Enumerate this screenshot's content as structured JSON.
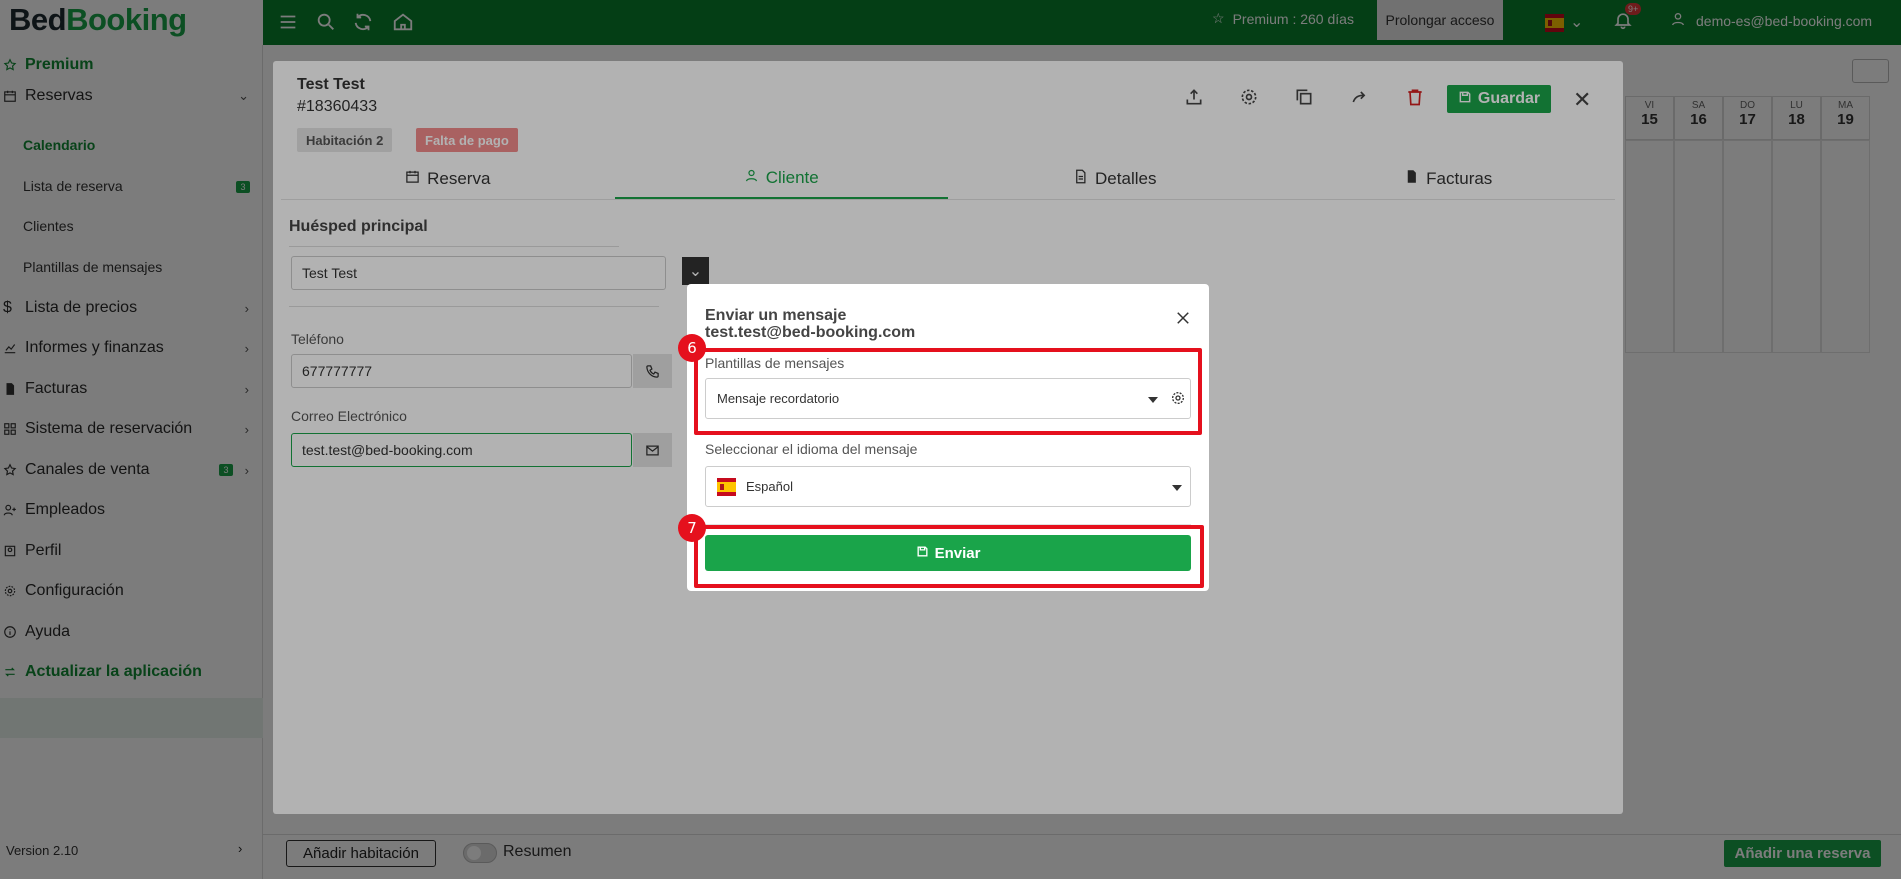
{
  "app": {
    "logo_part1": "Bed",
    "logo_part2": "Booking",
    "premium_text": "Premium : 260 días",
    "prolong_label": "Prolongar acceso",
    "notifications_badge": "9+",
    "user_email": "demo-es@bed-booking.com"
  },
  "sidebar": {
    "premium": "Premium",
    "reservas": "Reservas",
    "sub_calendario": "Calendario",
    "sub_lista": "Lista de reserva",
    "sub_lista_badge": "3",
    "sub_clientes": "Clientes",
    "sub_plantillas": "Plantillas de mensajes",
    "lista_precios": "Lista de precios",
    "informes": "Informes y finanzas",
    "facturas": "Facturas",
    "sistema": "Sistema de reservación",
    "canales": "Canales de venta",
    "canales_badge": "3",
    "empleados": "Empleados",
    "perfil": "Perfil",
    "configuracion": "Configuración",
    "ayuda": "Ayuda",
    "actualizar": "Actualizar la aplicación",
    "version": "Version 2.10"
  },
  "calendar": {
    "days": [
      {
        "name": "VI",
        "num": "15"
      },
      {
        "name": "SA",
        "num": "16"
      },
      {
        "name": "DO",
        "num": "17"
      },
      {
        "name": "LU",
        "num": "18"
      },
      {
        "name": "MA",
        "num": "19"
      }
    ],
    "add_room": "Añadir habitación",
    "resumen": "Resumen",
    "add_reserva": "Añadir una reserva"
  },
  "booking": {
    "guest_name": "Test Test",
    "booking_id": "#18360433",
    "room_tag": "Habitación 2",
    "payment_tag": "Falta de pago",
    "save_label": "Guardar",
    "tabs": {
      "reserva": "Reserva",
      "cliente": "Cliente",
      "detalles": "Detalles",
      "facturas": "Facturas"
    },
    "section_title": "Huésped principal",
    "guest_value": "Test Test",
    "phone_label": "Teléfono",
    "phone_value": "677777777",
    "email_label": "Correo Electrónico",
    "email_value": "test.test@bed-booking.com"
  },
  "dialog": {
    "title": "Enviar un mensaje",
    "email": "test.test@bed-booking.com",
    "templates_label": "Plantillas de mensajes",
    "template_selected": "Mensaje recordatorio",
    "language_label": "Seleccionar el idioma del mensaje",
    "language_selected": "Español",
    "send_label": "Enviar"
  },
  "annotations": {
    "step6": "6",
    "step7": "7"
  },
  "colors": {
    "brand_green": "#1aa44a",
    "topbar_green": "#09812d",
    "highlight_red": "#e5101d",
    "unpaid_tag": "#f28b8b"
  }
}
